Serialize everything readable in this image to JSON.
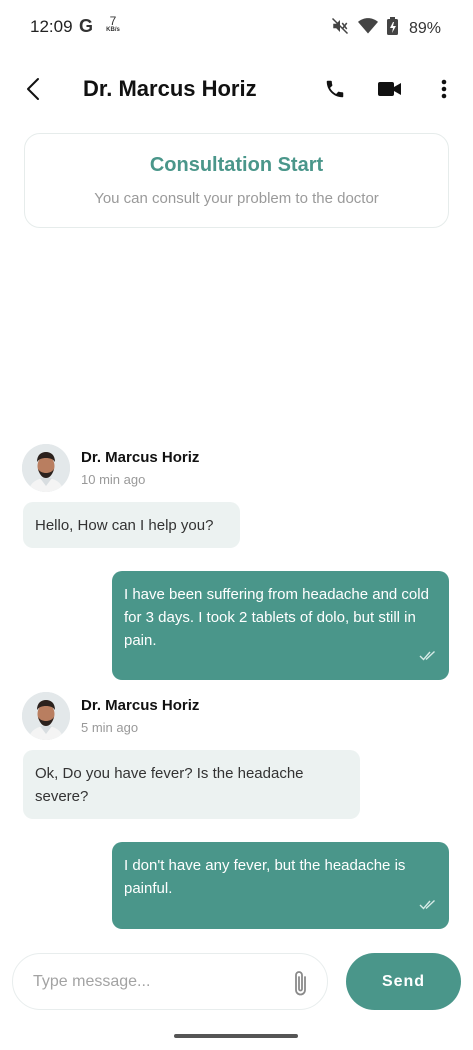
{
  "status_bar": {
    "time": "12:09",
    "g_label": "G",
    "network_speed": "7",
    "network_unit": "KB/s",
    "battery_percent": "89%",
    "icons": [
      "mute-icon",
      "wifi-icon",
      "battery-icon"
    ]
  },
  "header": {
    "title": "Dr. Marcus Horiz",
    "icons": [
      "back-icon",
      "phone-icon",
      "video-icon",
      "more-vert-icon"
    ]
  },
  "consultation": {
    "title": "Consultation Start",
    "subtitle": "You can consult your problem to the doctor"
  },
  "messages": [
    {
      "type": "received",
      "sender": "Dr. Marcus Horiz",
      "time": "10 min ago",
      "text": "Hello, How can I help you?"
    },
    {
      "type": "sent",
      "text": "I have been suffering from headache and cold for 3 days. I took 2 tablets of dolo, but still in pain.",
      "status": "read"
    },
    {
      "type": "received",
      "sender": "Dr. Marcus Horiz",
      "time": "5 min ago",
      "text": "Ok, Do you have fever? Is the headache severe?"
    },
    {
      "type": "sent",
      "text": "I don't have any fever, but the headache is painful.",
      "status": "read"
    }
  ],
  "composer": {
    "placeholder": "Type message...",
    "value": "",
    "send_label": "Send"
  },
  "colors": {
    "accent": "#4a968a",
    "incoming_bubble": "#ecf2f1",
    "muted_text": "#9a9a9a"
  }
}
